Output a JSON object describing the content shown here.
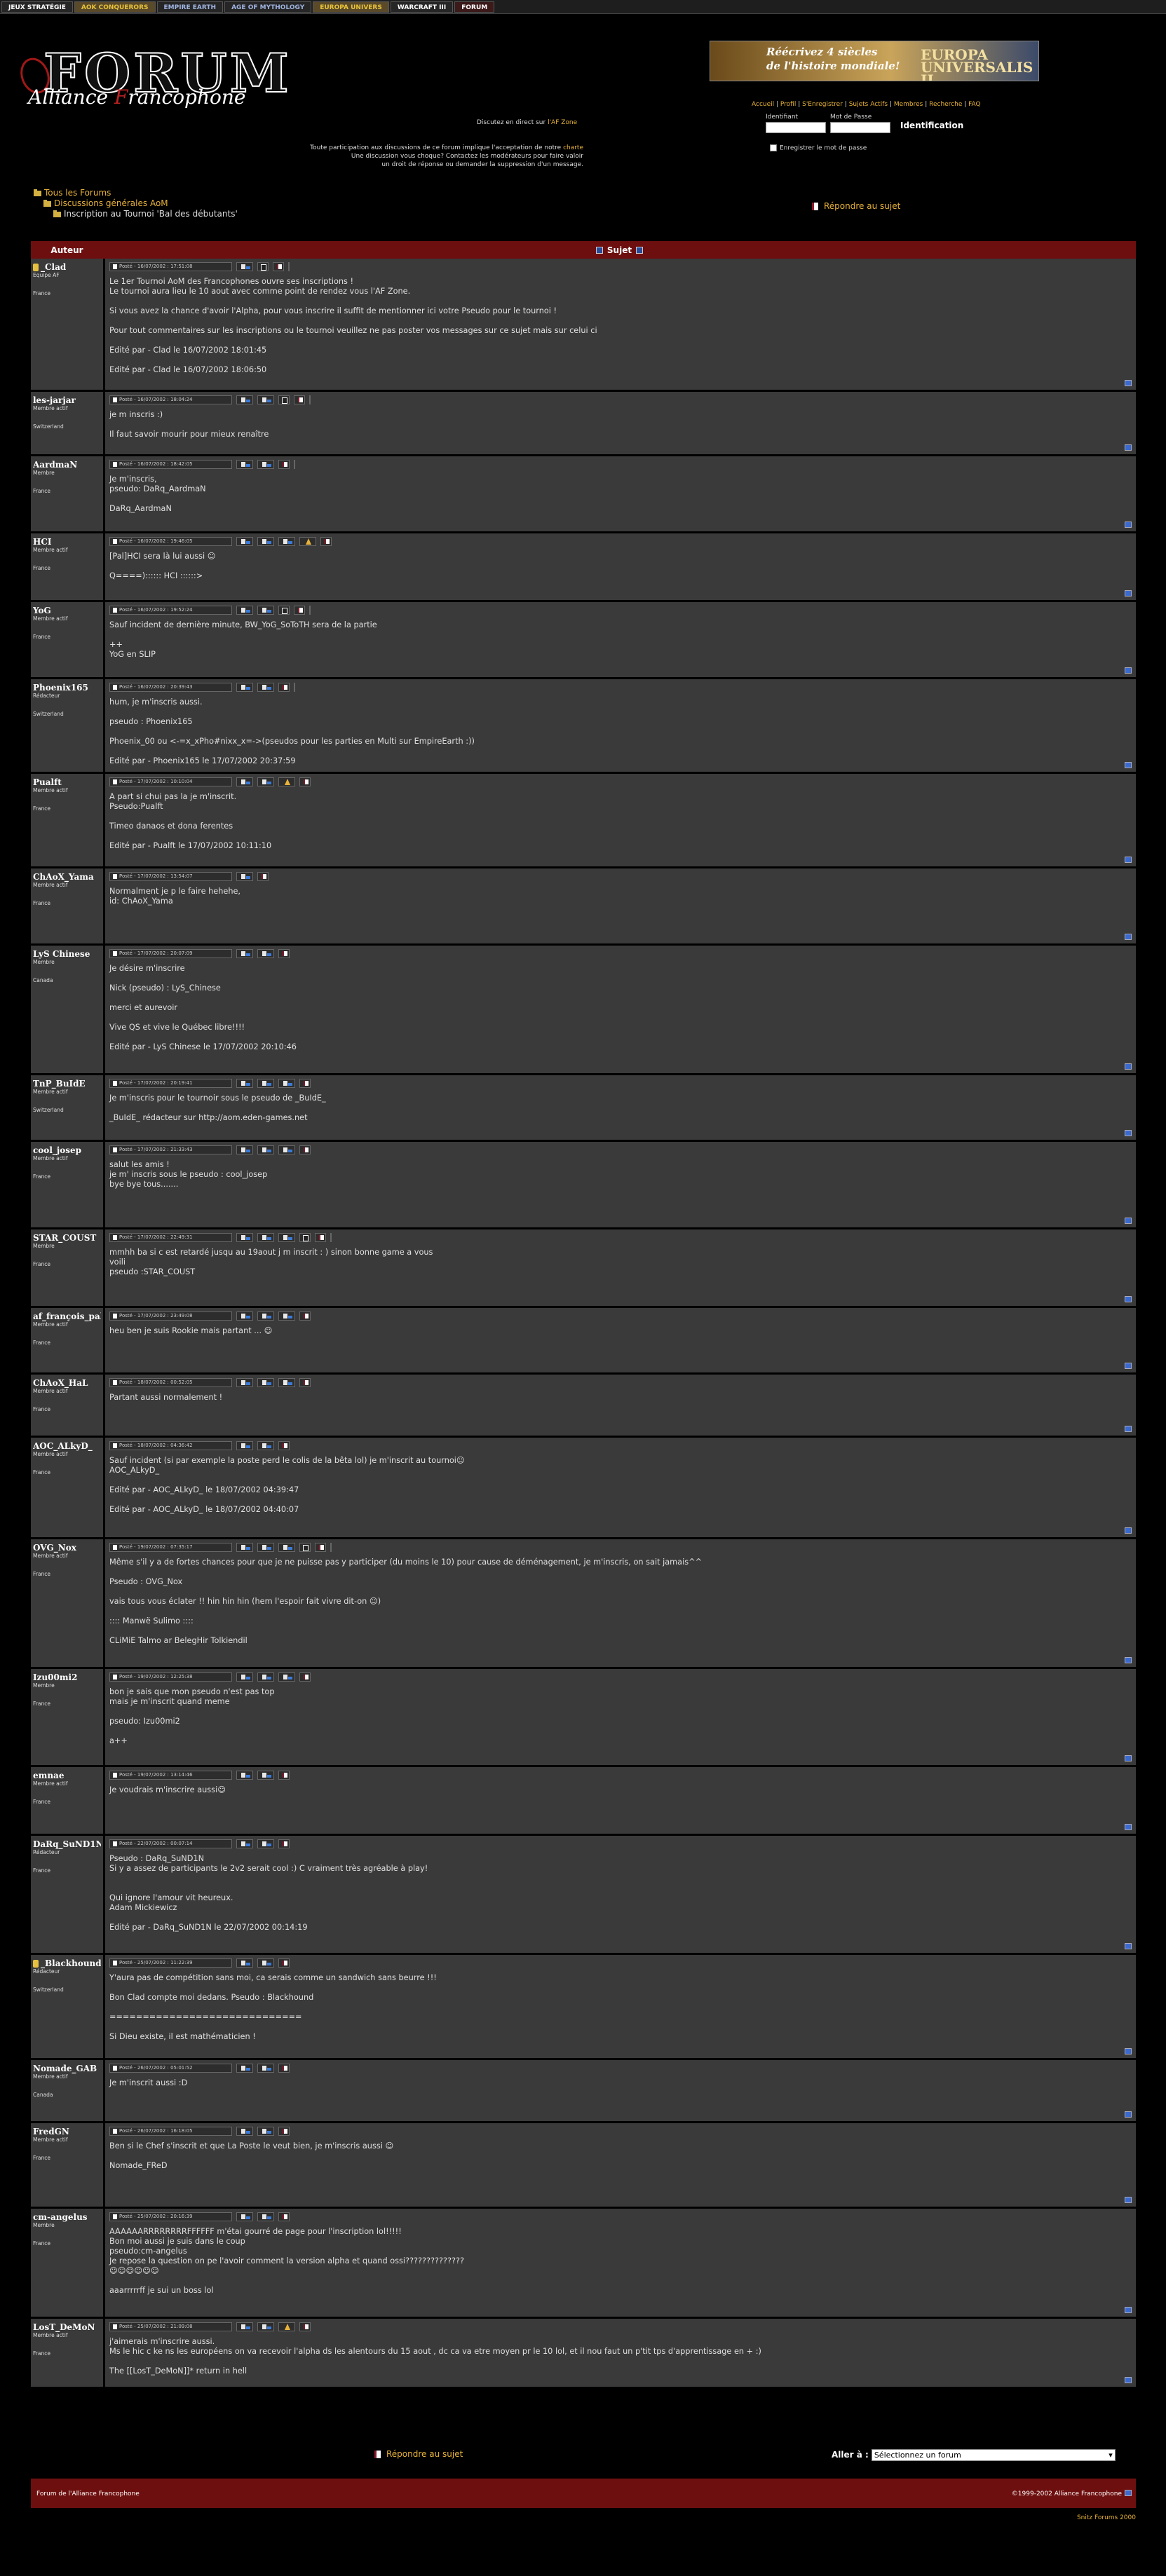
{
  "topnav": [
    "JEUX STRATÉGIE",
    "AOK CONQUERORS",
    "EMPIRE EARTH",
    "AGE OF MYTHOLOGY",
    "EUROPA UNIVERS",
    "WARCRAFT III",
    "FORUM"
  ],
  "logo": {
    "word": "FORUM",
    "line1": "Alliance ",
    "letter": "F",
    "line2": "rancophone"
  },
  "banner": {
    "line1": "Réécrivez 4 siècles",
    "line2": "de l'histoire mondiale!",
    "brand": "EUROPA UNIVERSALIS II"
  },
  "chat": {
    "prefix": "Discutez en direct sur ",
    "link": "l'AF Zone"
  },
  "rules": {
    "l1a": "Toute participation aux discussions de ce forum implique l'acceptation de notre ",
    "l1b": "charte",
    "l2": "Une discussion vous choque? Contactez les modérateurs pour faire valoir",
    "l3": "un droit de réponse ou demander la suppression d'un message."
  },
  "menu": [
    "Accueil",
    "Profil",
    "S'Enregistrer",
    "Sujets Actifs",
    "Membres",
    "Recherche",
    "FAQ"
  ],
  "login": {
    "user_label": "Identifiant",
    "pass_label": "Mot de Passe",
    "button": "Identification",
    "remember": "Enregistrer le mot de passe"
  },
  "breadcrumb": {
    "root": "Tous les Forums",
    "cat": "Discussions générales AoM",
    "topic": "Inscription au Tournoi 'Bal des débutants'"
  },
  "reply_label": "Répondre au sujet",
  "table": {
    "author": "Auteur",
    "subject": "Sujet"
  },
  "posts": [
    {
      "author": "_Clad",
      "rank": "Equipe AF",
      "country": "France",
      "date": "Posté - 16/07/2002 : 17:51:08",
      "tools": "isme",
      "text": "Le 1er Tournoi AoM des Francophones ouvre ses inscriptions !\nLe tournoi aura lieu le 10 aout avec comme point de rendez vous l'AF Zone.\n\nSi vous avez la chance d'avoir l'Alpha, pour vous inscrire il suffit de mentionner ici votre Pseudo pour le tournoi !\n\nPour tout commentaires sur les inscriptions ou le tournoi veuillez ne pas poster vos messages sur ce sujet mais sur celui ci\n\nEdité par - Clad le 16/07/2002 18:01:45\n\nEdité par - Clad le 16/07/2002 18:06:50",
      "h": 190,
      "icon": true
    },
    {
      "author": "les-jarjar",
      "rank": "Membre actif",
      "country": "Switzerland",
      "date": "Posté - 16/07/2002 : 18:04:24",
      "tools": "iisme",
      "text": "je m inscris :)\n\nIl faut savoir mourir pour mieux renaître",
      "h": 92
    },
    {
      "author": "AardmaN",
      "rank": "Membre",
      "country": "France",
      "date": "Posté - 16/07/2002 : 18:42:05",
      "tools": "iime",
      "text": "Je m'inscris,\npseudo: DaRq_AardmaN\n\nDaRq_AardmaN",
      "h": 110
    },
    {
      "author": "HCI",
      "rank": "Membre actif",
      "country": "France",
      "date": "Posté - 16/07/2002 : 19:46:05",
      "tools": "iiiwm",
      "text": "[Pal]HCI sera là lui aussi ☺\n\nQ====):::::: HCI ::::::>",
      "h": 98
    },
    {
      "author": "YoG",
      "rank": "Membre actif",
      "country": "France",
      "date": "Posté - 16/07/2002 : 19:52:24",
      "tools": "iisme",
      "text": "Sauf incident de dernière minute, BW_YoG_SoToTH sera de la partie\n\n++\nYoG en SLIP",
      "h": 110
    },
    {
      "author": "Phoenix165",
      "rank": "Rédacteur",
      "country": "Switzerland",
      "date": "Posté - 16/07/2002 : 20:39:43",
      "tools": "iime",
      "text": "hum, je m'inscris aussi.\n\npseudo : Phoenix165\n\nPhoenix_00 ou <-=x_xPho#nixx_x=->(pseudos pour les parties en Multi sur EmpireEarth :))\n\nEdité par - Phoenix165 le 17/07/2002 20:37:59",
      "h": 135
    },
    {
      "author": "Pualft",
      "rank": "Membre actif",
      "country": "France",
      "date": "Posté - 17/07/2002 : 10:10:04",
      "tools": "iiwm",
      "text": "A part si chui pas la je m'inscrit.\nPseudo:Pualft\n\nTimeo danaos et dona ferentes\n\nEdité par - Pualft le 17/07/2002 10:11:10",
      "h": 135
    },
    {
      "author": "ChAoX_Yama",
      "rank": "Membre actif",
      "country": "France",
      "date": "Posté - 17/07/2002 : 13:54:07",
      "tools": "im",
      "text": "Normalment je p le faire hehehe,\nid: ChAoX_Yama",
      "h": 110
    },
    {
      "author": "LyS Chinese",
      "rank": "Membre",
      "country": "Canada",
      "date": "Posté - 17/07/2002 : 20:07:09",
      "tools": "iim",
      "text": "Je désire m'inscrire\n\nNick (pseudo) : LyS_Chinese\n\nmerci et aurevoir\n\nVive QS et vive le Québec libre!!!!\n\nEdité par - LyS Chinese le 17/07/2002 20:10:46",
      "h": 185
    },
    {
      "author": "TnP_BuIdE",
      "rank": "Membre actif",
      "country": "Switzerland",
      "date": "Posté - 17/07/2002 : 20:19:41",
      "tools": "iiim",
      "text": "Je m'inscris pour le tournoir sous le pseudo de _BuIdE_\n\n_BuIdE_ rédacteur sur http://aom.eden-games.net",
      "h": 95
    },
    {
      "author": "cool_josep",
      "rank": "Membre actif",
      "country": "France",
      "date": "Posté - 17/07/2002 : 21:33:43",
      "tools": "iiim",
      "text": "salut les amis !\nje m' inscris sous le pseudo : cool_josep\nbye bye tous.......",
      "h": 125
    },
    {
      "author": "STAR_COUST",
      "rank": "Membre",
      "country": "France",
      "date": "Posté - 17/07/2002 : 22:49:31",
      "tools": "iiisme",
      "text": "mmhh ba si c est retardé jusqu au 19aout j m inscrit : ) sinon bonne game a vous\nvoili\npseudo :STAR_COUST",
      "h": 112
    },
    {
      "author": "af_françois_pal",
      "rank": "Membre actif",
      "country": "France",
      "date": "Posté - 17/07/2002 : 23:49:08",
      "tools": "iiim",
      "text": "heu ben je suis Rookie mais partant ... ☺",
      "h": 95
    },
    {
      "author": "ChAoX_HaL",
      "rank": "Membre actif",
      "country": "France",
      "date": "Posté - 18/07/2002 : 00:52:05",
      "tools": "iiim",
      "text": "Partant aussi normalement !",
      "h": 90
    },
    {
      "author": "AOC_ALkyD_",
      "rank": "Membre actif",
      "country": "France",
      "date": "Posté - 18/07/2002 : 04:36:42",
      "tools": "iim",
      "text": "Sauf incident (si par exemple la poste perd le colis de la bêta lol) je m'inscrit au tournoi☺\nAOC_ALkyD_\n\nEdité par - AOC_ALkyD_ le 18/07/2002 04:39:47\n\nEdité par - AOC_ALkyD_ le 18/07/2002 04:40:07",
      "h": 145
    },
    {
      "author": "OVG_Nox",
      "rank": "Membre actif",
      "country": "France",
      "date": "Posté - 19/07/2002 : 07:35:17",
      "tools": "iiisme",
      "text": "Même s'il y a de fortes chances pour que je ne puisse pas y participer (du moins le 10) pour cause de déménagement, je m'inscris, on sait jamais^^\n\nPseudo : OVG_Nox\n\nvais tous vous éclater !! hin hin hin (hem l'espoir fait vivre dit-on ☺)\n\n:::: Manwë Sulimo ::::\n\nCLiMiE Talmo ar BelegHir Tolkiendil",
      "h": 185
    },
    {
      "author": "Izu00mi2",
      "rank": "Membre",
      "country": "France",
      "date": "Posté - 19/07/2002 : 12:25:38",
      "tools": "iiim",
      "text": "bon je sais que mon pseudo n'est pas top\nmais je m'inscrit quand meme\n\npseudo: Izu00mi2\n\na++",
      "h": 140
    },
    {
      "author": "emnae",
      "rank": "Membre actif",
      "country": "France",
      "date": "Posté - 19/07/2002 : 13:14:46",
      "tools": "iim",
      "text": "Je voudrais m'inscrire aussi☺",
      "h": 98
    },
    {
      "author": "DaRq_SuND1N",
      "rank": "Rédacteur",
      "country": "France",
      "date": "Posté - 22/07/2002 : 00:07:14",
      "tools": "iim",
      "text": "Pseudo : DaRq_SuND1N\nSi y a assez de participants le 2v2 serait cool :) C vraiment très agréable à play!\n\n\nQui ignore l'amour vit heureux.\nAdam Mickiewicz\n\nEdité par - DaRq_SuND1N le 22/07/2002 00:14:19",
      "h": 170
    },
    {
      "author": "_Blackhound",
      "rank": "Rédacteur",
      "country": "Switzerland",
      "date": "Posté - 25/07/2002 : 11:22:39",
      "tools": "iim",
      "text": "Y'aura pas de compétition sans moi, ca serais comme un sandwich sans beurre !!!\n\nBon Clad compte moi dedans. Pseudo : Blackhound\n\n=============================\n\nSi Dieu existe, il est mathématicien !",
      "h": 150,
      "icon": true
    },
    {
      "author": "Nomade_GAB",
      "rank": "Membre actif",
      "country": "Canada",
      "date": "Posté - 26/07/2002 : 05:01:52",
      "tools": "iim",
      "text": "Je m'inscrit aussi :D",
      "h": 90
    },
    {
      "author": "FredGN",
      "rank": "Membre actif",
      "country": "France",
      "date": "Posté - 26/07/2002 : 16:18:05",
      "tools": "iim",
      "text": "Ben si le Chef s'inscrit et que La Poste le veut bien, je m'inscris aussi ☺\n\nNomade_FReD",
      "h": 122
    },
    {
      "author": "cm-angelus",
      "rank": "Membre",
      "country": "France",
      "date": "Posté - 25/07/2002 : 20:16:39",
      "tools": "iim",
      "text": "AAAAAARRRRRRRRFFFFFF m'étai gourré de page pour l'inscription lol!!!!!\nBon moi aussi je suis dans le coup\npseudo:cm-angelus\nJe repose la question on pe l'avoir comment la version alpha et quand ossi??????????????\n☺☺☺☺☺☺\n\naaarrrrrff je sui un boss lol",
      "h": 157
    },
    {
      "author": "LosT_DeMoN",
      "rank": "Membre actif",
      "country": "France",
      "date": "Posté - 25/07/2002 : 21:09:08",
      "tools": "iiwm",
      "text": "j'aimerais m'inscrire aussi.\nMs le hic c ke ns les européens on va recevoir l'alpha ds les alentours du 15 aout , dc ca va etre moyen pr le 10 lol, et il nou faut un p'tit tps d'apprentissage en + :)\n\nThe [[LosT_DeMoN]]* return in hell",
      "h": 100
    }
  ],
  "goto": {
    "label": "Aller à :",
    "placeholder": "Sélectionnez un forum"
  },
  "footer": {
    "left": "Forum de l'Alliance Francophone",
    "right": "©1999-2002 Alliance Francophone"
  },
  "powered": "Snitz Forums 2000"
}
